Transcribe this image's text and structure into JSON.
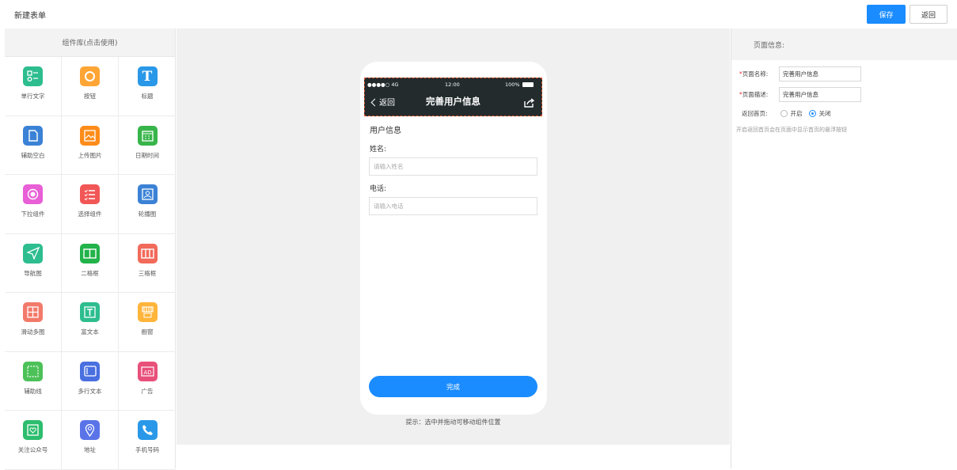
{
  "header": {
    "title": "新建表单",
    "save_label": "保存",
    "back_label": "返回"
  },
  "library": {
    "title": "组件库(点击使用)",
    "items": [
      {
        "label": "单行文字",
        "icon": "single-line-text-icon",
        "color": "#2dbd8e"
      },
      {
        "label": "按钮",
        "icon": "button-icon",
        "color": "#ffa535"
      },
      {
        "label": "标题",
        "icon": "title-icon",
        "color": "#2a98e8"
      },
      {
        "label": "辅助空白",
        "icon": "blank-icon",
        "color": "#3b82d6"
      },
      {
        "label": "上传图片",
        "icon": "upload-image-icon",
        "color": "#ff8c1a"
      },
      {
        "label": "日期时间",
        "icon": "calendar-icon",
        "color": "#38b54a"
      },
      {
        "label": "下拉组件",
        "icon": "dropdown-icon",
        "color": "#e85fd6"
      },
      {
        "label": "选择组件",
        "icon": "select-list-icon",
        "color": "#f25757"
      },
      {
        "label": "轮播图",
        "icon": "carousel-icon",
        "color": "#3b82d6"
      },
      {
        "label": "导航图",
        "icon": "navigation-icon",
        "color": "#2dbd8e"
      },
      {
        "label": "二格框",
        "icon": "two-grid-icon",
        "color": "#22b34a"
      },
      {
        "label": "三格框",
        "icon": "three-grid-icon",
        "color": "#f26a5a"
      },
      {
        "label": "滑动多图",
        "icon": "slide-images-icon",
        "color": "#f27a6a"
      },
      {
        "label": "富文本",
        "icon": "rich-text-icon",
        "color": "#2dbd8e"
      },
      {
        "label": "橱窗",
        "icon": "showcase-icon",
        "color": "#ffb43a"
      },
      {
        "label": "辅助线",
        "icon": "guide-line-icon",
        "color": "#4cc158"
      },
      {
        "label": "多行文本",
        "icon": "multiline-text-icon",
        "color": "#4a6fe0"
      },
      {
        "label": "广告",
        "icon": "ad-icon",
        "color": "#e84f7a"
      },
      {
        "label": "关注公众号",
        "icon": "follow-account-icon",
        "color": "#2dbd6e"
      },
      {
        "label": "地址",
        "icon": "location-icon",
        "color": "#5a74e8"
      },
      {
        "label": "手机号码",
        "icon": "phone-icon",
        "color": "#2a98e8"
      }
    ]
  },
  "phone": {
    "status_signal": "●●●●○ 4G",
    "status_time": "12:00",
    "status_battery": "100%",
    "back_label": "返回",
    "nav_title": "完善用户信息",
    "form_title": "用户信息",
    "fields": [
      {
        "label": "姓名:",
        "placeholder": "请输入姓名"
      },
      {
        "label": "电话:",
        "placeholder": "请输入电话"
      }
    ],
    "done_label": "完成"
  },
  "hint": "提示：选中并拖动可移动组件位置",
  "props": {
    "title": "页面信息:",
    "name_label": "页面名称:",
    "name_value": "完善用户信息",
    "desc_label": "页面描述:",
    "desc_value": "完善用户信息",
    "home_label": "返回首页:",
    "option_on": "开启",
    "option_off": "关闭",
    "selected": "关闭",
    "note": "开启返回首页会在页面中显示首页的悬浮按钮"
  },
  "colors": {
    "accent": "#1a8cff",
    "nav_bg": "#232b2d"
  }
}
